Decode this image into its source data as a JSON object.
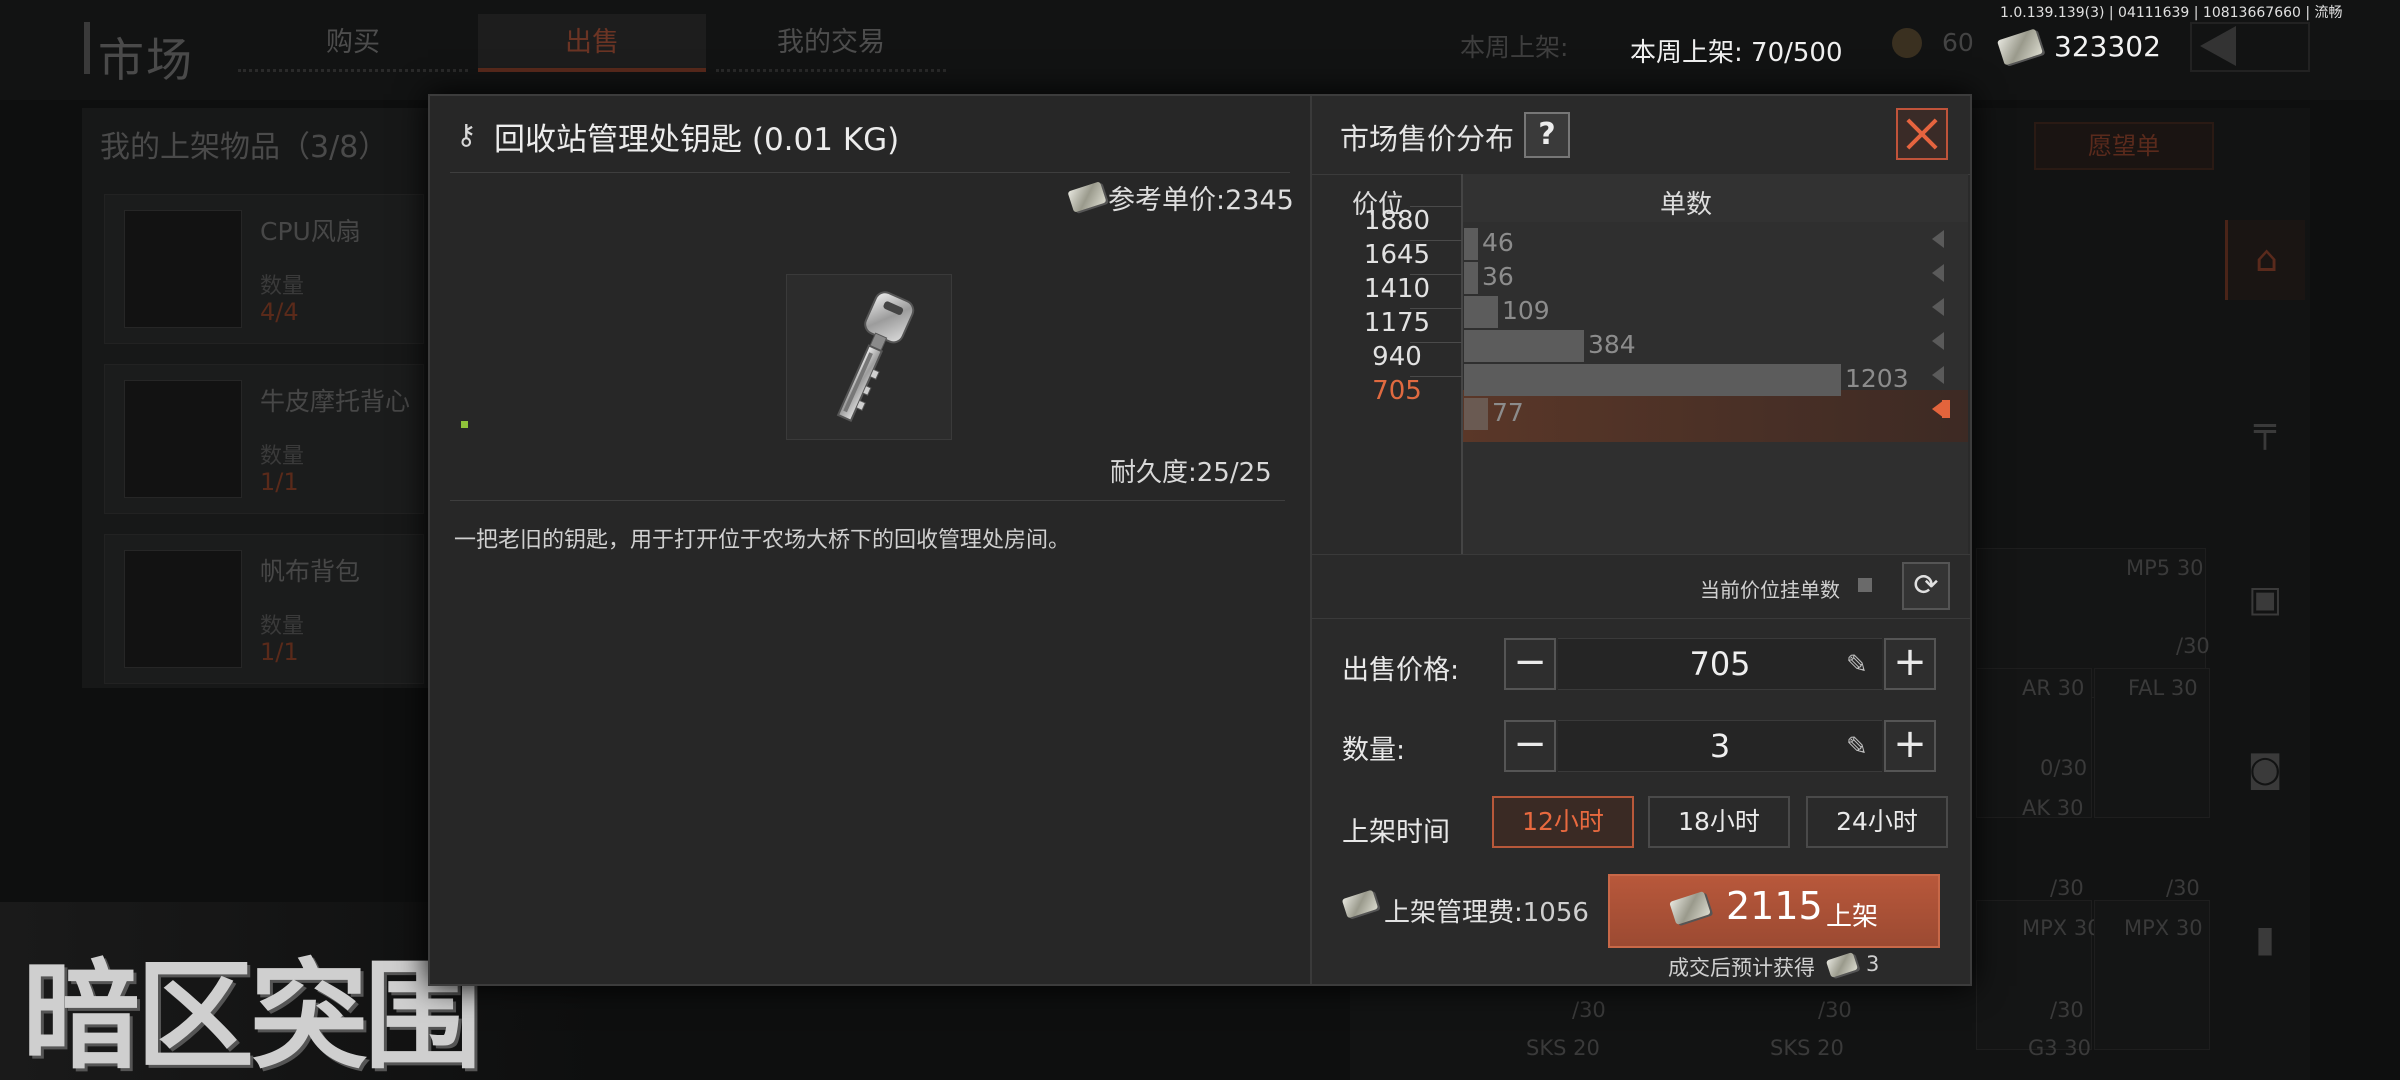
{
  "version": "1.0.139.139(3) | 04111639 | 10813667660 | 流畅",
  "header": {
    "title": "市场",
    "tabs": [
      {
        "label": "购买",
        "active": false
      },
      {
        "label": "出售",
        "active": true
      },
      {
        "label": "我的交易",
        "active": false
      }
    ],
    "weekly_listing_label": "本周上架:",
    "weekly_listing_value": "70/500",
    "coin_value": "60",
    "money_value": "323302"
  },
  "my_listings": {
    "title": "我的上架物品（3/8）",
    "qty_label": "数量",
    "items": [
      {
        "name": "CPU风扇",
        "qty": "4/4"
      },
      {
        "name": "牛皮摩托背心",
        "qty": "1/1"
      },
      {
        "name": "帆布背包",
        "qty": "1/1"
      }
    ]
  },
  "right_panel": {
    "wishlist_label": "愿望单",
    "grid_labels": [
      "MP5 30",
      "AR 30",
      "FAL 30",
      "AK 30",
      "MPX 30",
      "MPX 30",
      "SKS 20",
      "SKS 20",
      "G3 30"
    ],
    "grid_counts": [
      "/30",
      "0/30",
      "/30",
      "/30",
      "/30",
      "/30",
      "/30"
    ]
  },
  "logo_text": "暗区突围",
  "item": {
    "title": "回收站管理处钥匙 (0.01 KG)",
    "ref_price_label": "参考单价:",
    "ref_price": "2345",
    "durability_label": "耐久度:",
    "durability": "25/25",
    "description": "一把老旧的钥匙，用于打开位于农场大桥下的回收管理处房间。"
  },
  "distribution": {
    "title": "市场售价分布",
    "help_label": "?",
    "col_price": "价位",
    "col_count": "单数",
    "current_price_count_label": "当前价位挂单数"
  },
  "chart_data": {
    "type": "bar",
    "orientation": "horizontal",
    "title": "市场售价分布",
    "xlabel": "单数",
    "ylabel": "价位",
    "categories": [
      "1880",
      "1645",
      "1410",
      "1175",
      "940",
      "705"
    ],
    "values": [
      46,
      36,
      109,
      384,
      1203,
      77
    ],
    "highlight_category": "705",
    "xlim": [
      0,
      1500
    ],
    "colors": {
      "bar": "#5c5c5c",
      "highlight": "#e3643c"
    }
  },
  "sell_form": {
    "price_label": "出售价格:",
    "price_value": "705",
    "qty_label": "数量:",
    "qty_value": "3",
    "duration_label": "上架时间",
    "durations": [
      {
        "label": "12小时",
        "active": true
      },
      {
        "label": "18小时",
        "active": false
      },
      {
        "label": "24小时",
        "active": false
      }
    ],
    "fee_label": "上架管理费:",
    "fee_value": "1056",
    "list_total": "2115",
    "list_button_label": "上架",
    "expected_label": "成交后预计获得",
    "expected_value": "3"
  },
  "colors": {
    "accent": "#e3643c",
    "button": "#a9523a",
    "panel": "#2a2a2a"
  },
  "icons": {
    "close": "close-icon",
    "help": "help-icon",
    "refresh": "refresh-icon",
    "minus": "minus-icon",
    "plus": "plus-icon",
    "pencil": "pencil-icon",
    "money": "money-icon",
    "key": "key-icon"
  }
}
